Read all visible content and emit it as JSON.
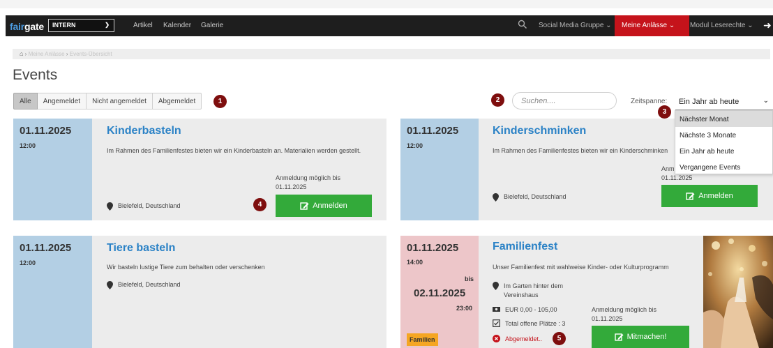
{
  "app": {
    "logo_part1": "fair",
    "logo_part2": "gate",
    "org_select": "INTERN",
    "nav_links": [
      "Artikel",
      "Kalender",
      "Galerie"
    ],
    "right_nav": [
      "Social Media Gruppe",
      "Meine Anlässe",
      "Modul Leserechte"
    ]
  },
  "breadcrumb": {
    "items": [
      "Meine Anlässe",
      "Events-Übersicht"
    ]
  },
  "page": {
    "title": "Events"
  },
  "filters": {
    "buttons": [
      "Alle",
      "Angemeldet",
      "Nicht angemeldet",
      "Abgemeldet"
    ],
    "active_index": 0
  },
  "markers": [
    "1",
    "2",
    "3",
    "4",
    "5"
  ],
  "search": {
    "placeholder": "Suchen...."
  },
  "zeitspanne": {
    "label": "Zeitspanne:",
    "selected": "Ein Jahr ab heute",
    "options": [
      "Nächster Monat",
      "Nächste 3 Monate",
      "Ein Jahr ab heute",
      "Vergangene Events"
    ],
    "highlighted_index": 0
  },
  "events": [
    {
      "date": "01.11.2025",
      "time": "12:00",
      "title": "Kinderbasteln",
      "description": "Im Rahmen des Familienfestes bieten wir ein Kinderbasteln an. Materialien werden gestellt.",
      "location": "Bielefeld, Deutschland",
      "registration_label": "Anmeldung möglich bis",
      "registration_date": "01.11.2025",
      "button": "Anmelden"
    },
    {
      "date": "01.11.2025",
      "time": "12:00",
      "title": "Kinderschminken",
      "description": "Im Rahmen des Familienfestes bieten wir ein Kinderschminken",
      "location": "Bielefeld, Deutschland",
      "registration_label": "Anm",
      "registration_date": "01.11.2025",
      "button": "Anmelden"
    },
    {
      "date": "01.11.2025",
      "time": "12:00",
      "title": "Tiere basteln",
      "description": "Wir basteln lustige Tiere zum behalten oder verschenken",
      "location": "Bielefeld, Deutschland"
    },
    {
      "date": "01.11.2025",
      "time": "14:00",
      "until_label": "bis",
      "end_date": "02.11.2025",
      "end_time": "23:00",
      "title": "Familienfest",
      "description": "Unser Familienfest mit wahlweise Kinder- oder Kulturprogramm",
      "location_line1": "Im Garten hinter dem",
      "location_line2": "Vereinshaus",
      "price": "EUR 0,00 - 105,00",
      "places": "Total offene Plätze : 3",
      "status": "Abgemeldet..",
      "registration_label": "Anmeldung möglich bis",
      "registration_date": "01.11.2025",
      "button": "Mitmachen!",
      "tag": "Familien"
    }
  ],
  "colors": {
    "accent_blue": "#2b82c6",
    "date_blue": "#b3cfe4",
    "date_pink": "#edc6c9",
    "button_green": "#33aa3a",
    "nav_red": "#c5131b",
    "marker_red": "#7e0e0e"
  }
}
